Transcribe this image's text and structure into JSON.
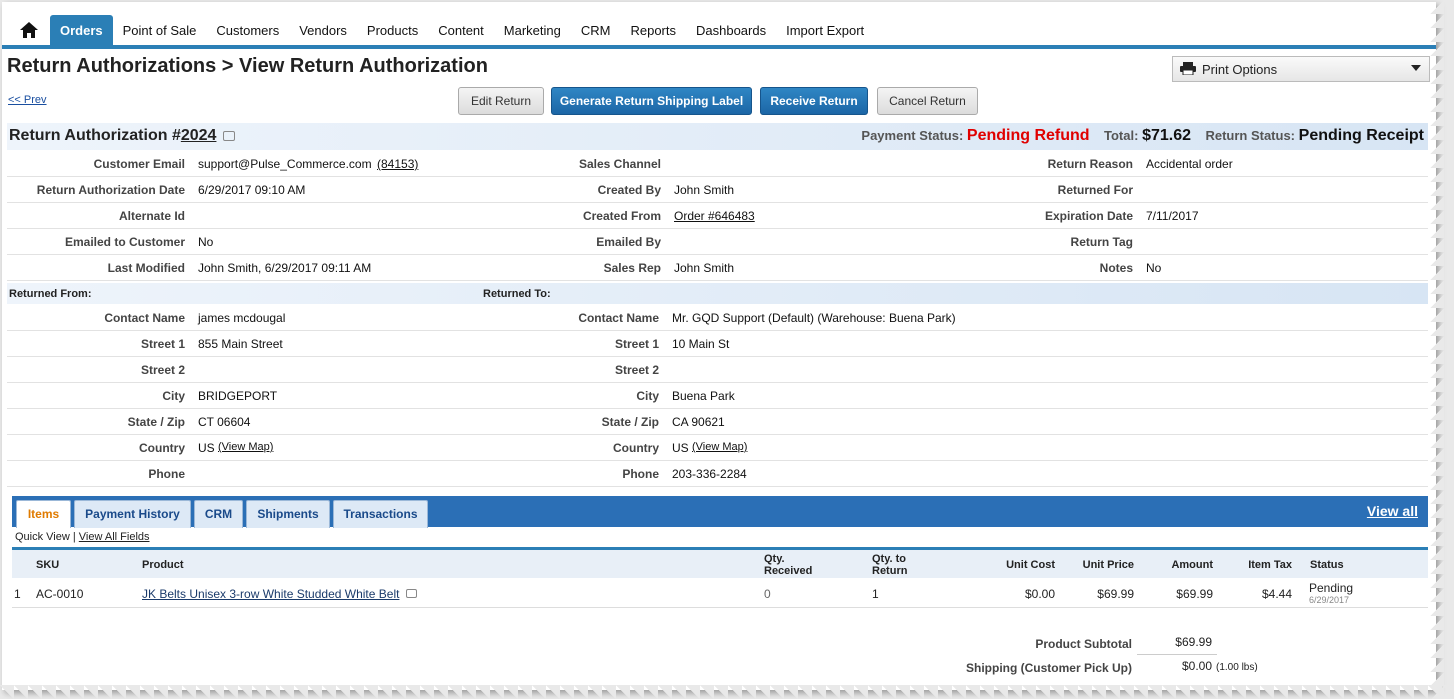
{
  "nav": {
    "items": [
      "Orders",
      "Point of Sale",
      "Customers",
      "Vendors",
      "Products",
      "Content",
      "Marketing",
      "CRM",
      "Reports",
      "Dashboards",
      "Import Export"
    ]
  },
  "page_title": "Return Authorizations > View Return Authorization",
  "print_options": "Print Options",
  "prev_link": "<< Prev",
  "buttons": {
    "edit": "Edit Return",
    "generate_label": "Generate Return Shipping Label",
    "receive": "Receive Return",
    "cancel": "Cancel Return"
  },
  "ra": {
    "title_prefix": "Return Authorization #",
    "number": "2024",
    "payment_status_label": "Payment Status:",
    "payment_status": "Pending Refund",
    "total_label": "Total:",
    "total": "$71.62",
    "return_status_label": "Return Status:",
    "return_status": "Pending Receipt"
  },
  "details": {
    "col1": [
      {
        "label": "Customer Email",
        "value": "support@Pulse_Commerce.com",
        "extra": "(84153)"
      },
      {
        "label": "Return Authorization Date",
        "value": "6/29/2017 09:10 AM"
      },
      {
        "label": "Alternate Id",
        "value": ""
      },
      {
        "label": "Emailed to Customer",
        "value": "No"
      },
      {
        "label": "Last Modified",
        "value": "John Smith, 6/29/2017 09:11 AM"
      }
    ],
    "col2": [
      {
        "label": "Sales Channel",
        "value": ""
      },
      {
        "label": "Created By",
        "value": "John Smith"
      },
      {
        "label": "Created From",
        "value": "Order #646483"
      },
      {
        "label": "Emailed By",
        "value": ""
      },
      {
        "label": "Sales Rep",
        "value": "John Smith"
      }
    ],
    "col3": [
      {
        "label": "Return Reason",
        "value": "Accidental order"
      },
      {
        "label": "Returned For",
        "value": ""
      },
      {
        "label": "Expiration Date",
        "value": "7/11/2017"
      },
      {
        "label": "Return Tag",
        "value": ""
      },
      {
        "label": "Notes",
        "value": "No"
      }
    ]
  },
  "returned_from_label": "Returned From:",
  "returned_to_label": "Returned To:",
  "address": {
    "labels": [
      "Contact Name",
      "Street 1",
      "Street 2",
      "City",
      "State / Zip",
      "Country",
      "Phone"
    ],
    "from": [
      "james mcdougal",
      "855 Main Street",
      "",
      "BRIDGEPORT",
      "CT 06604",
      "US",
      ""
    ],
    "to": [
      "Mr. GQD Support (Default) (Warehouse: Buena Park)",
      "10 Main St",
      "",
      "Buena Park",
      "CA 90621",
      "US",
      "203-336-2284"
    ],
    "view_map": "(View Map)"
  },
  "tabs": [
    "Items",
    "Payment History",
    "CRM",
    "Shipments",
    "Transactions"
  ],
  "view_all": "View all",
  "quick_view": "Quick View |",
  "view_all_fields": "View All Fields",
  "table": {
    "headers": [
      "SKU",
      "Product",
      "Qty. Received",
      "Qty. to Return",
      "Unit Cost",
      "Unit Price",
      "Amount",
      "Item Tax",
      "Status"
    ],
    "rows": [
      {
        "index": "1",
        "sku": "AC-0010",
        "product": "JK Belts Unisex 3-row White Studded White Belt",
        "qty_received": "0",
        "qty_return": "1",
        "unit_cost": "$0.00",
        "unit_price": "$69.99",
        "amount": "$69.99",
        "tax": "$4.44",
        "status": "Pending",
        "status_date": "6/29/2017"
      }
    ]
  },
  "summary": {
    "subtotal_label": "Product Subtotal",
    "subtotal": "$69.99",
    "shipping_label": "Shipping (Customer Pick Up)",
    "shipping": "$0.00",
    "shipping_weight": "(1.00 lbs)"
  }
}
